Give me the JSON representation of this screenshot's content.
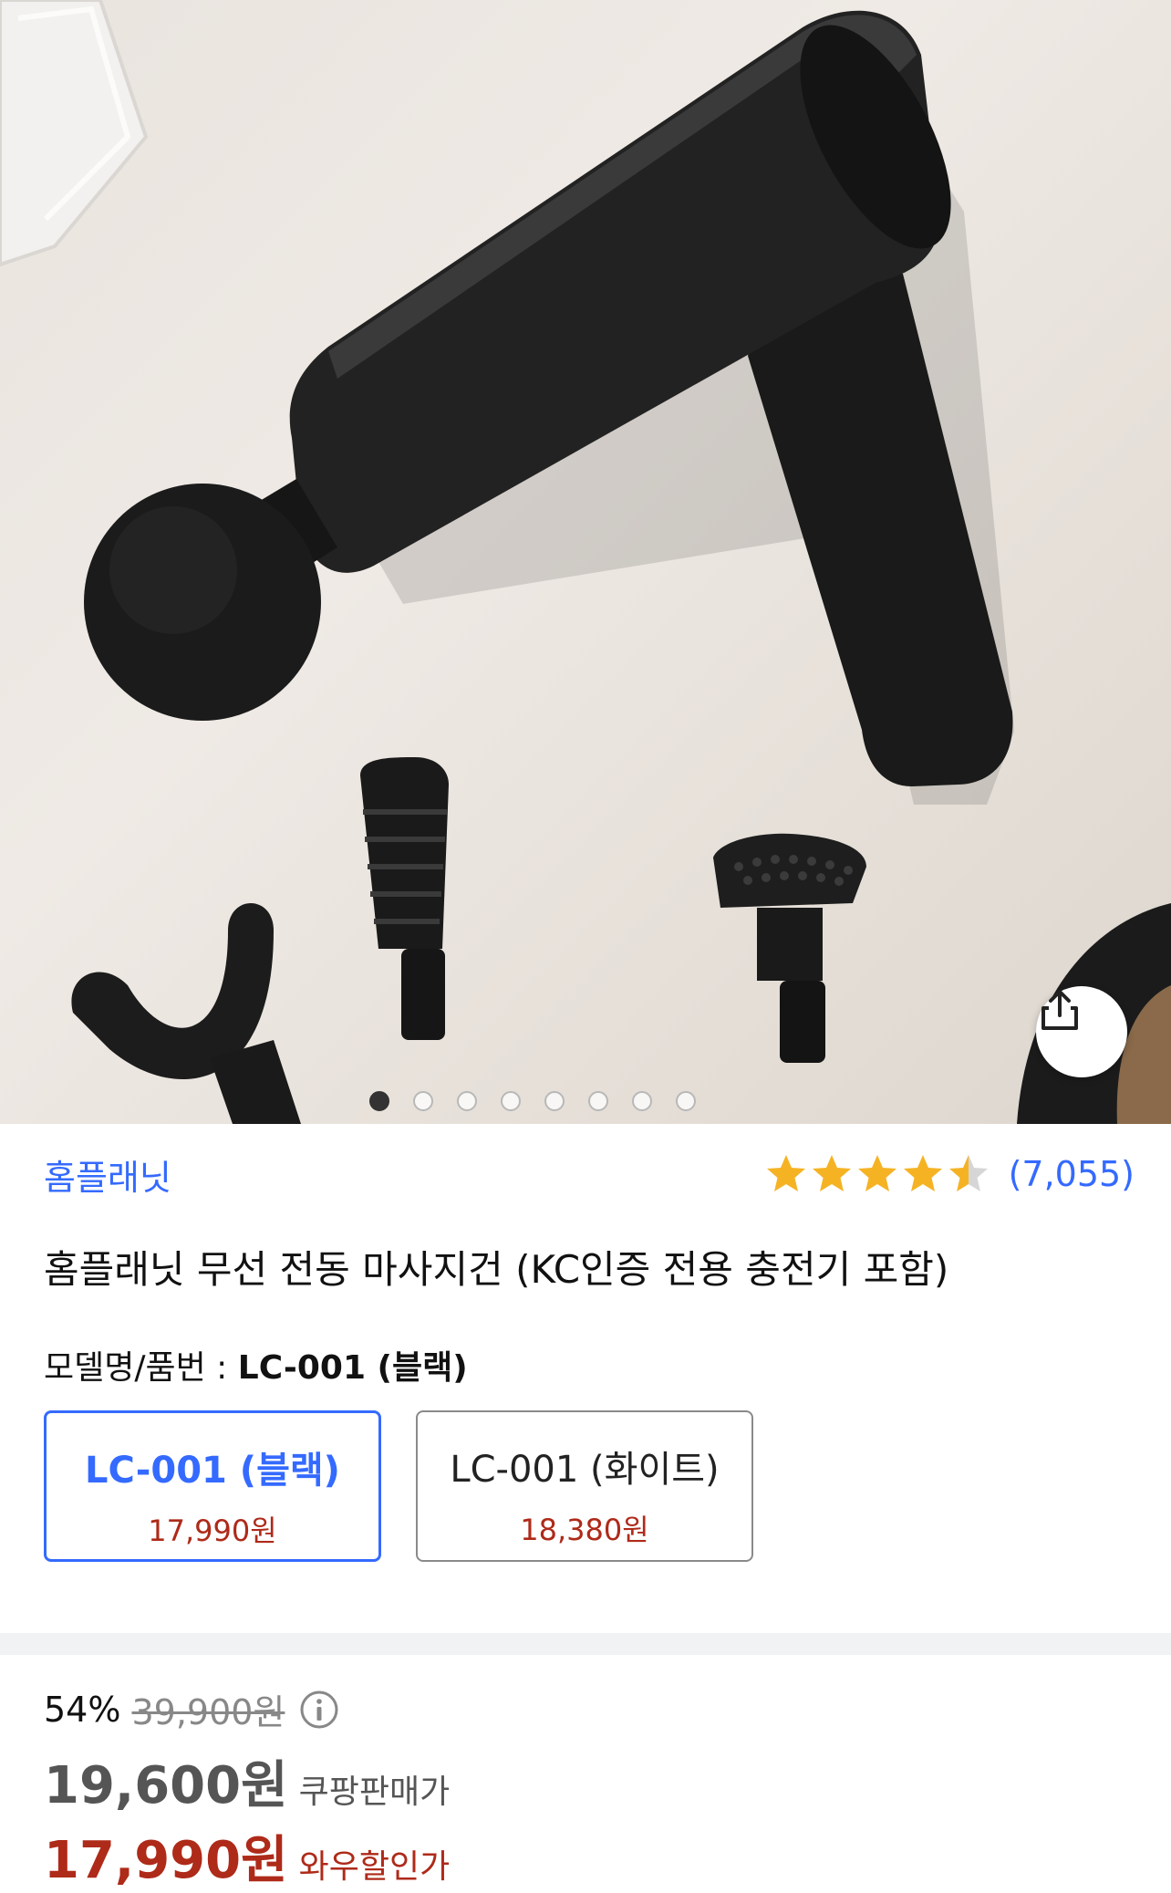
{
  "gallery": {
    "total_images": 8,
    "current_index": 1,
    "share_icon": "share-icon"
  },
  "product": {
    "brand": "홈플래닛",
    "rating": 4.5,
    "review_count": "(7,055)",
    "title": "홈플래닛 무선 전동 마사지건 (KC인증 전용 충전기 포함)",
    "model_label": "모델명/품번 : ",
    "model_selected": "LC-001 (블랙)"
  },
  "options": [
    {
      "name": "LC-001 (블랙)",
      "price": "17,990원",
      "selected": true
    },
    {
      "name": "LC-001 (화이트)",
      "price": "18,380원",
      "selected": false
    }
  ],
  "pricing": {
    "discount_rate": "54%",
    "original_price": "39,900원",
    "coupang_price": "19,600원",
    "coupang_label": "쿠팡판매가",
    "wow_price": "17,990원",
    "wow_label": "와우할인가"
  },
  "colors": {
    "accent": "#346aff",
    "price_red": "#ae2a19",
    "star": "#f5b324"
  }
}
